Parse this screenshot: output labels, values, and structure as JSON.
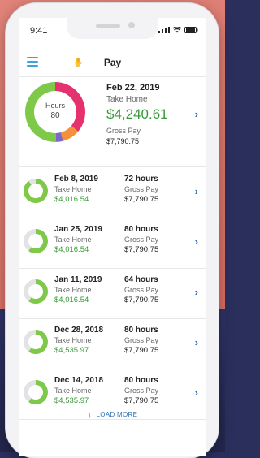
{
  "status": {
    "time": "9:41"
  },
  "nav": {
    "title": "Pay"
  },
  "summary": {
    "date": "Feb 22, 2019",
    "take_home_label": "Take Home",
    "take_home": "$4,240.61",
    "gross_label": "Gross Pay",
    "gross": "$7,790.75",
    "donut_label": "Hours",
    "donut_value": "80",
    "colors": [
      "#e5316f",
      "#f4913a",
      "#7b68c8",
      "#7ec84a"
    ]
  },
  "rows": [
    {
      "date": "Feb 8, 2019",
      "take_label": "Take Home",
      "take_home": "$4,016.54",
      "hours": "72 hours",
      "gross_label": "Gross Pay",
      "gross": "$7,790.75",
      "ratio": 0.9
    },
    {
      "date": "Jan 25, 2019",
      "take_label": "Take Home",
      "take_home": "$4,016.54",
      "hours": "80 hours",
      "gross_label": "Gross Pay",
      "gross": "$7,790.75",
      "ratio": 0.6
    },
    {
      "date": "Jan 11, 2019",
      "take_label": "Take Home",
      "take_home": "$4,016.54",
      "hours": "64 hours",
      "gross_label": "Gross Pay",
      "gross": "$7,790.75",
      "ratio": 0.6
    },
    {
      "date": "Dec 28, 2018",
      "take_label": "Take Home",
      "take_home": "$4,535.97",
      "hours": "80 hours",
      "gross_label": "Gross Pay",
      "gross": "$7,790.75",
      "ratio": 0.6
    },
    {
      "date": "Dec 14, 2018",
      "take_label": "Take Home",
      "take_home": "$4,535.97",
      "hours": "80 hours",
      "gross_label": "Gross Pay",
      "gross": "$7,790.75",
      "ratio": 0.6
    }
  ],
  "load_more": "LOAD MORE",
  "colors": {
    "accent": "#2e6fb3",
    "green": "#3a9a3a",
    "menu": "#3aa3dc"
  }
}
